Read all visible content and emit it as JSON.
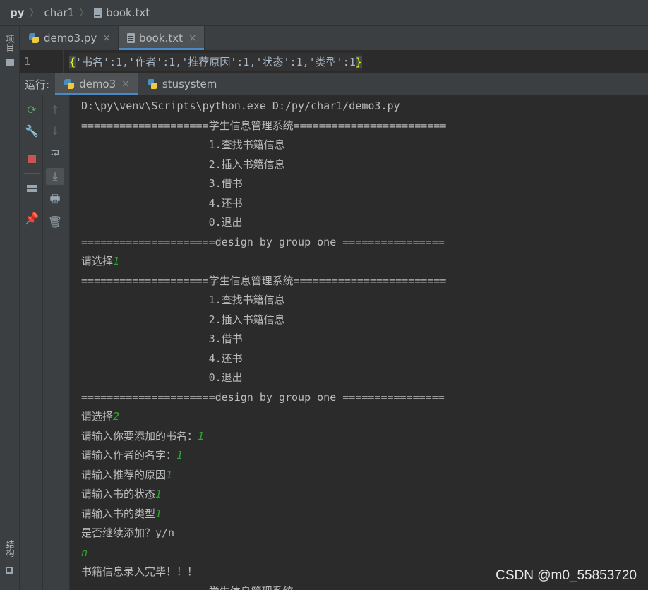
{
  "breadcrumb": {
    "project": "py",
    "folder": "char1",
    "file": "book.txt"
  },
  "left_stripe": {
    "project_label": "项目",
    "structure_label": "结构"
  },
  "editor_tabs": [
    {
      "label": "demo3.py",
      "icon": "python-file-icon",
      "active": false
    },
    {
      "label": "book.txt",
      "icon": "text-file-icon",
      "active": true
    }
  ],
  "editor": {
    "line_number": "1",
    "brace_open": "{",
    "code": "'书名':1,'作者':1,'推荐原因':1,'状态':1,'类型':1",
    "brace_close": "}"
  },
  "run_panel": {
    "label": "运行:",
    "tabs": [
      {
        "label": "demo3",
        "icon": "python-icon",
        "active": true
      },
      {
        "label": "stusystem",
        "icon": "python-icon",
        "active": false
      }
    ]
  },
  "toolbar_icons": [
    "rerun-icon",
    "wrench-icon",
    "stop-icon",
    "layout-icon",
    "pin-icon",
    "up-arrow-icon",
    "down-arrow-icon",
    "soft-wrap-icon",
    "scroll-to-end-icon",
    "print-icon",
    "trash-icon"
  ],
  "console": {
    "lines": [
      {
        "text": "D:\\py\\venv\\Scripts\\python.exe D:/py/char1/demo3.py",
        "input": ""
      },
      {
        "text": "====================学生信息管理系统========================",
        "input": ""
      },
      {
        "text": "                    1.查找书籍信息",
        "input": ""
      },
      {
        "text": "                    2.插入书籍信息",
        "input": ""
      },
      {
        "text": "                    3.借书",
        "input": ""
      },
      {
        "text": "                    4.还书",
        "input": ""
      },
      {
        "text": "                    0.退出",
        "input": ""
      },
      {
        "text": "=====================design by group one ================",
        "input": ""
      },
      {
        "text": "请选择",
        "input": "1"
      },
      {
        "text": "====================学生信息管理系统========================",
        "input": ""
      },
      {
        "text": "                    1.查找书籍信息",
        "input": ""
      },
      {
        "text": "                    2.插入书籍信息",
        "input": ""
      },
      {
        "text": "                    3.借书",
        "input": ""
      },
      {
        "text": "                    4.还书",
        "input": ""
      },
      {
        "text": "                    0.退出",
        "input": ""
      },
      {
        "text": "=====================design by group one ================",
        "input": ""
      },
      {
        "text": "请选择",
        "input": "2"
      },
      {
        "text": "请输入你要添加的书名：",
        "input": "1"
      },
      {
        "text": "请输入作者的名字：",
        "input": "1"
      },
      {
        "text": "请输入推荐的原因",
        "input": "1"
      },
      {
        "text": "请输入书的状态",
        "input": "1"
      },
      {
        "text": "请输入书的类型",
        "input": "1"
      },
      {
        "text": "是否继续添加？y/n",
        "input": ""
      },
      {
        "text": "",
        "input": "n"
      },
      {
        "text": "书籍信息录入完毕！！！",
        "input": ""
      },
      {
        "text": "====================学生信息管理系统========================",
        "input": ""
      }
    ]
  },
  "watermark": "CSDN @m0_55853720",
  "colors": {
    "background": "#2b2b2b",
    "panel": "#3c3f41",
    "accent": "#4a88c7",
    "user_input": "#2fa52f"
  }
}
